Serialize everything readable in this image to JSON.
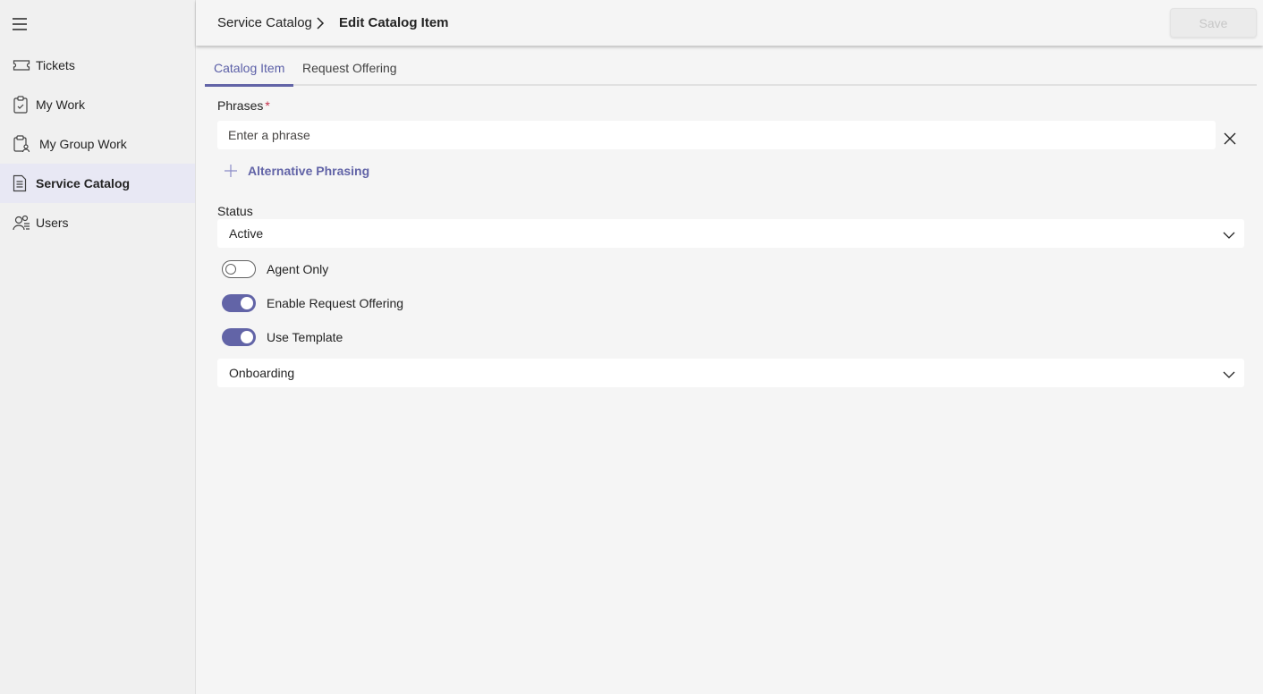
{
  "sidebar": {
    "items": [
      {
        "label": "Tickets",
        "icon": "ticket-icon"
      },
      {
        "label": "My Work",
        "icon": "clipboard-icon"
      },
      {
        "label": "My Group Work",
        "icon": "group-work-icon"
      },
      {
        "label": "Service Catalog",
        "icon": "document-icon"
      },
      {
        "label": "Users",
        "icon": "users-icon"
      }
    ],
    "active_item": "Service Catalog"
  },
  "header": {
    "breadcrumb": [
      "Service Catalog",
      "Edit Catalog Item"
    ],
    "save_label": "Save"
  },
  "tabs": [
    {
      "label": "Catalog Item",
      "active": true
    },
    {
      "label": "Request Offering",
      "active": false
    }
  ],
  "form": {
    "phrases_label": "Phrases",
    "phrases_required_mark": "*",
    "phrase_placeholder": "Enter a phrase",
    "alternative_phrasing_label": "Alternative Phrasing",
    "status_label": "Status",
    "status_value": "Active",
    "toggles": [
      {
        "label": "Agent Only",
        "on": false
      },
      {
        "label": "Enable Request Offering",
        "on": true
      },
      {
        "label": "Use Template",
        "on": true
      }
    ],
    "template_value": "Onboarding"
  },
  "colors": {
    "accent": "#6264a7",
    "required": "#c4314b",
    "background": "#f5f5f5",
    "sidebar": "#f0f0f0"
  }
}
